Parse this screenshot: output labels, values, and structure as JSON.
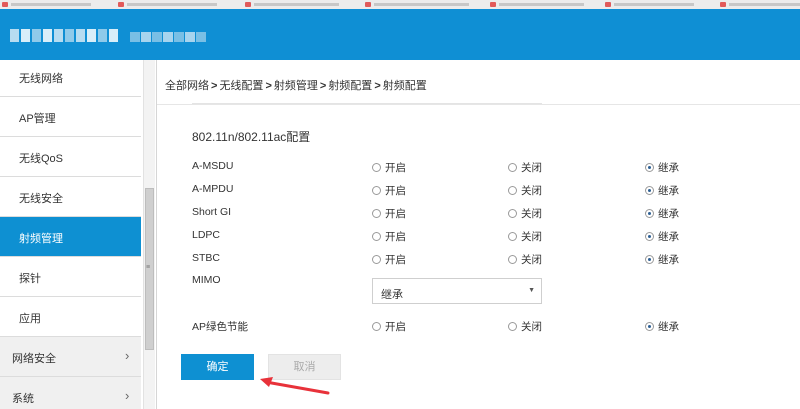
{
  "breadcrumb": {
    "items": [
      "全部网络",
      "无线配置",
      "射频管理",
      "射频配置",
      "射频配置"
    ],
    "separator": ">"
  },
  "sidebar": {
    "items": [
      {
        "label": "无线网络"
      },
      {
        "label": "AP管理"
      },
      {
        "label": "无线QoS"
      },
      {
        "label": "无线安全"
      },
      {
        "label": "射频管理",
        "active": true
      },
      {
        "label": "探针"
      },
      {
        "label": "应用"
      }
    ],
    "groups": [
      {
        "label": "网络安全",
        "chevron": "›"
      },
      {
        "label": "系统",
        "chevron": "›"
      }
    ]
  },
  "section": {
    "title": "802.11n/802.11ac配置"
  },
  "options": {
    "on": "开启",
    "off": "关闭",
    "inherit": "继承"
  },
  "settings": [
    {
      "label": "A-MSDU",
      "selected": "inherit"
    },
    {
      "label": "A-MPDU",
      "selected": "inherit"
    },
    {
      "label": "Short GI",
      "selected": "inherit"
    },
    {
      "label": "LDPC",
      "selected": "inherit"
    },
    {
      "label": "STBC",
      "selected": "inherit"
    },
    {
      "label": "AP绿色节能",
      "selected": "inherit"
    }
  ],
  "mimo": {
    "label": "MIMO",
    "value": "继承",
    "arrow": "▼"
  },
  "buttons": {
    "ok": "确定",
    "cancel": "取消"
  },
  "colors": {
    "accent": "#0e90d2",
    "annotation": "#e8323a"
  },
  "icons": {
    "scroll_grip": "≡"
  }
}
